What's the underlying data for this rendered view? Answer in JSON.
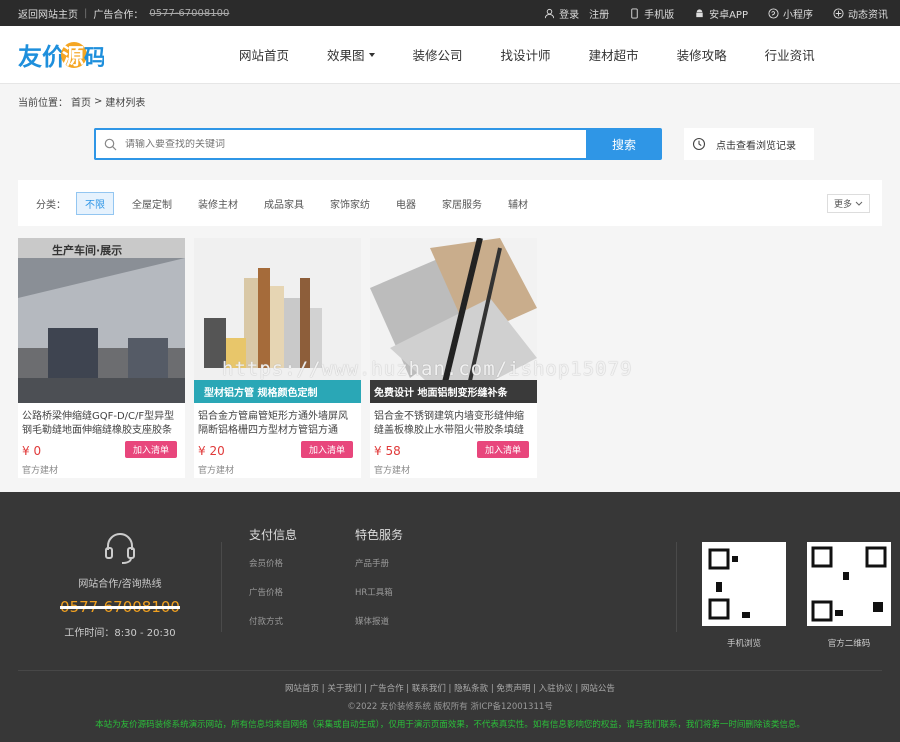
{
  "topbar": {
    "home_link": "返回网站主页",
    "ad_label": "广告合作：",
    "ad_phone": "0577-67008100",
    "login": "登录",
    "register": "注册",
    "mobile": "手机版",
    "android": "安卓APP",
    "miniprogram": "小程序",
    "news": "动态资讯"
  },
  "logo": {
    "text": "友价源码"
  },
  "nav": [
    {
      "label": "网站首页"
    },
    {
      "label": "效果图"
    },
    {
      "label": "装修公司"
    },
    {
      "label": "找设计师"
    },
    {
      "label": "建材超市"
    },
    {
      "label": "装修攻略"
    },
    {
      "label": "行业资讯"
    }
  ],
  "breadcrumb": {
    "prefix": "当前位置：",
    "home": "首页",
    "sep": ">",
    "current": "建材列表"
  },
  "search": {
    "placeholder": "请输入要查找的关键词",
    "button": "搜索",
    "history": "点击查看浏览记录"
  },
  "category": {
    "label": "分类：",
    "items": [
      "不限",
      "全屋定制",
      "装修主材",
      "成品家具",
      "家饰家纺",
      "电器",
      "家居服务",
      "辅材"
    ],
    "more": "更多"
  },
  "products": [
    {
      "title": "公路桥梁伸缩缝GQF-D/C/F型异型钢毛勒缝地面伸缩缝橡胶支座胶条",
      "price": "¥ 0",
      "add": "加入清单",
      "brand": "官方建材",
      "banner": "生产车间·展示"
    },
    {
      "title": "铝合金方管扁管矩形方通外墙屏风隔断铝格栅四方型材方管铝方通",
      "price": "¥ 20",
      "add": "加入清单",
      "brand": "官方建材",
      "banner": "型材铝方管 规格颜色定制"
    },
    {
      "title": "铝合金不锈钢建筑内墙变形缝伸缩缝盖板橡胶止水带阻火带胶条填缝",
      "price": "¥ 58",
      "add": "加入清单",
      "brand": "官方建材",
      "banner": "免费设计 地面铝制变形缝补条"
    }
  ],
  "watermark": "https://www.huzhan.com/ishop15079",
  "footer": {
    "contact_label": "网站合作/咨询热线",
    "phone": "0577-67008100",
    "hours": "工作时间：8:30 - 20:30",
    "col1": {
      "heading": "支付信息",
      "links": [
        "会员价格",
        "广告价格",
        "付款方式"
      ]
    },
    "col2": {
      "heading": "特色服务",
      "links": [
        "产品手册",
        "HR工具箱",
        "媒体报道"
      ]
    },
    "qr1_label": "手机浏览",
    "qr2_label": "官方二维码",
    "links": "网站首页 | 关于我们 | 广告合作 | 联系我们 | 隐私条款 | 免责声明 | 入驻协议 | 网站公告",
    "copyright": "©2022 友价装修系统 版权所有 浙ICP备12001311号",
    "notice": "本站为友价源码装修系统演示网站，所有信息均来自网络（采集或自动生成），仅用于演示页面效果，不代表真实性。如有信息影响您的权益，请与我们联系，我们将第一时间删除该类信息。"
  },
  "colors": {
    "accent": "#2f96e6",
    "pink": "#e8467c",
    "price": "#e03a3a",
    "footer_bg": "#373737",
    "notice": "#2bbf3a"
  }
}
